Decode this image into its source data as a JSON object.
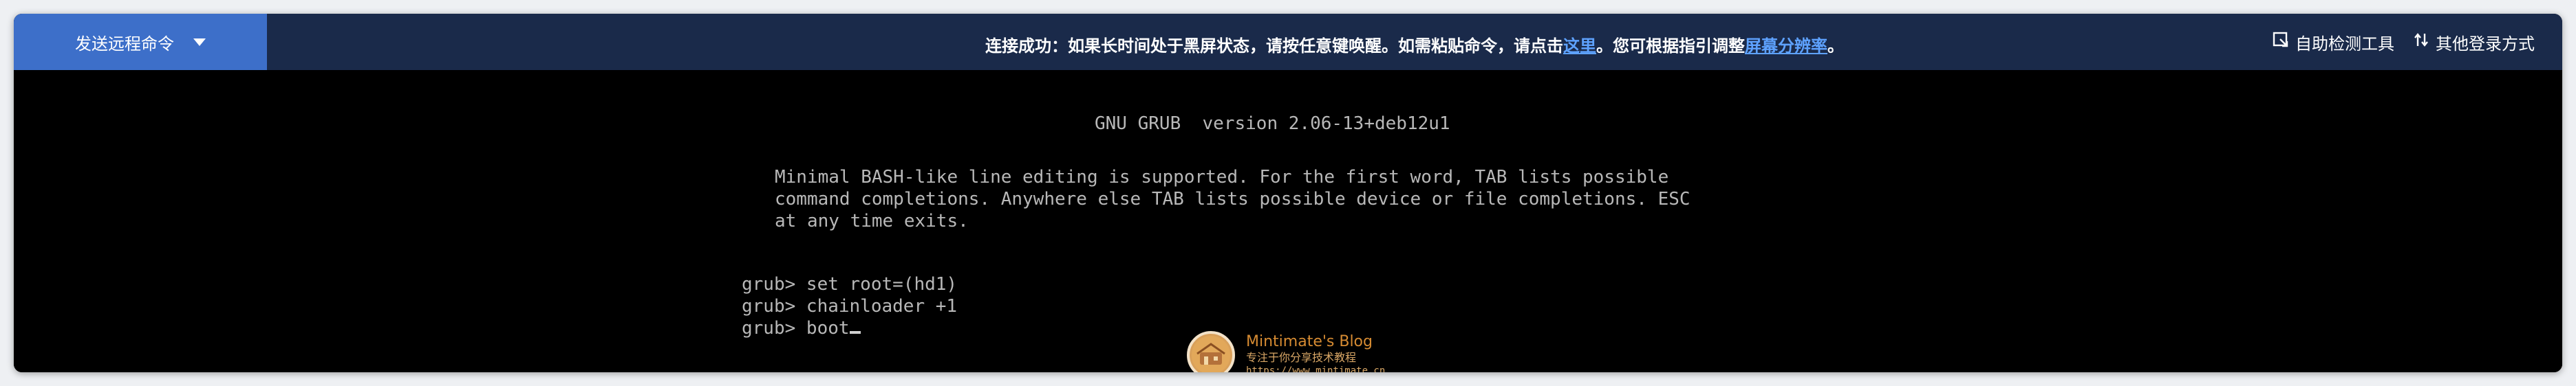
{
  "toolbar": {
    "send_command_label": "发送远程命令"
  },
  "notice": {
    "part1": "连接成功：如果长时间处于黑屏状态，请按任意键唤醒。如需粘贴命令，请点击",
    "link1": "这里",
    "part2": "。您可根据指引调整",
    "link2": "屏幕分辨率",
    "part3": "。"
  },
  "tools": {
    "auto_detect_label": "自助检测工具",
    "other_login_label": "其他登录方式"
  },
  "terminal": {
    "header": "GNU GRUB  version 2.06-13+deb12u1",
    "info_lines": [
      "Minimal BASH-like line editing is supported. For the first word, TAB lists possible",
      "command completions. Anywhere else TAB lists possible device or file completions. ESC",
      "at any time exits."
    ],
    "commands": [
      "grub> set root=(hd1)",
      "grub> chainloader +1",
      "grub> boot"
    ]
  },
  "watermark": {
    "title": "Mintimate's Blog",
    "subtitle": "专注于你分享技术教程",
    "url": "https://www.mintimate.cn"
  },
  "colors": {
    "topbar_bg": "#1a2a4a",
    "button_bg": "#3d6fc9",
    "link": "#5ea2ff",
    "terminal_text": "#b8b8b8",
    "watermark_accent": "#d68b32"
  }
}
